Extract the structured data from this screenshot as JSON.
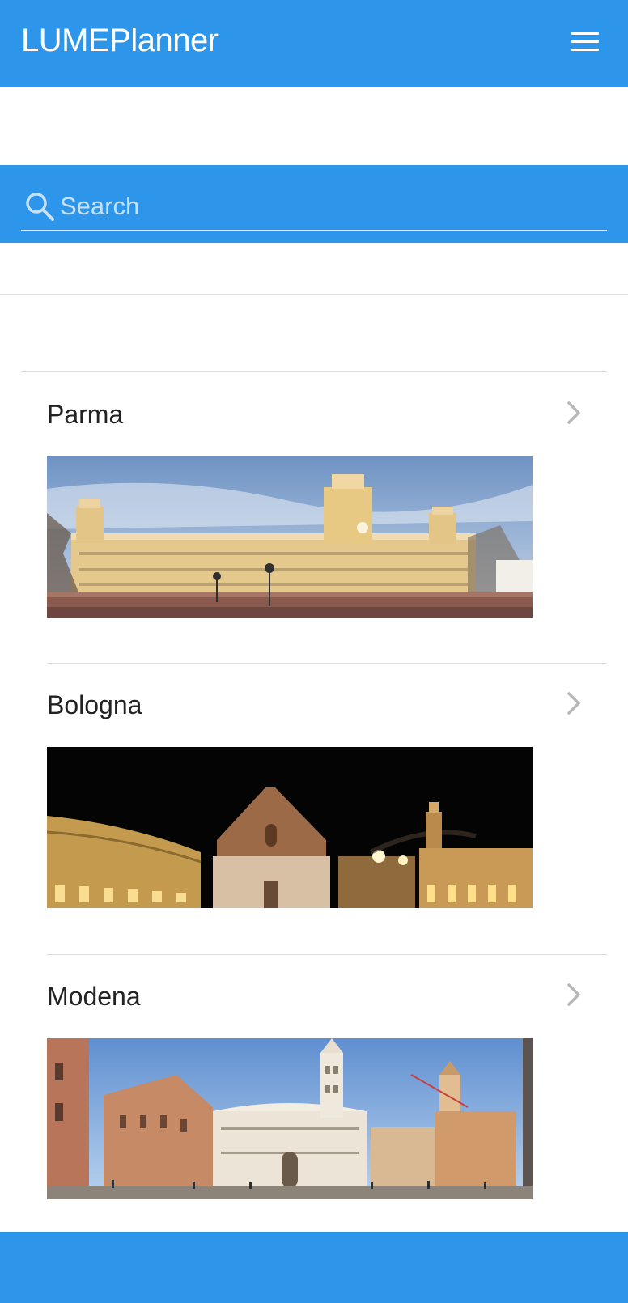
{
  "header": {
    "title": "LUMEPlanner",
    "menu_icon": "hamburger-menu-icon"
  },
  "search": {
    "placeholder": "Search",
    "icon": "search-icon"
  },
  "cities": [
    {
      "name": "Parma",
      "photo": "panorama of Palazzo Ducale di Colorno"
    },
    {
      "name": "Bologna",
      "photo": "night panorama of Piazza Maggiore"
    },
    {
      "name": "Modena",
      "photo": "panorama of Piazza Grande with cathedral and Ghirlandina tower"
    }
  ],
  "colors": {
    "primary": "#2d96eb",
    "divider": "#dcdcdc",
    "chevron": "#b8b8b8",
    "text": "#222222"
  }
}
